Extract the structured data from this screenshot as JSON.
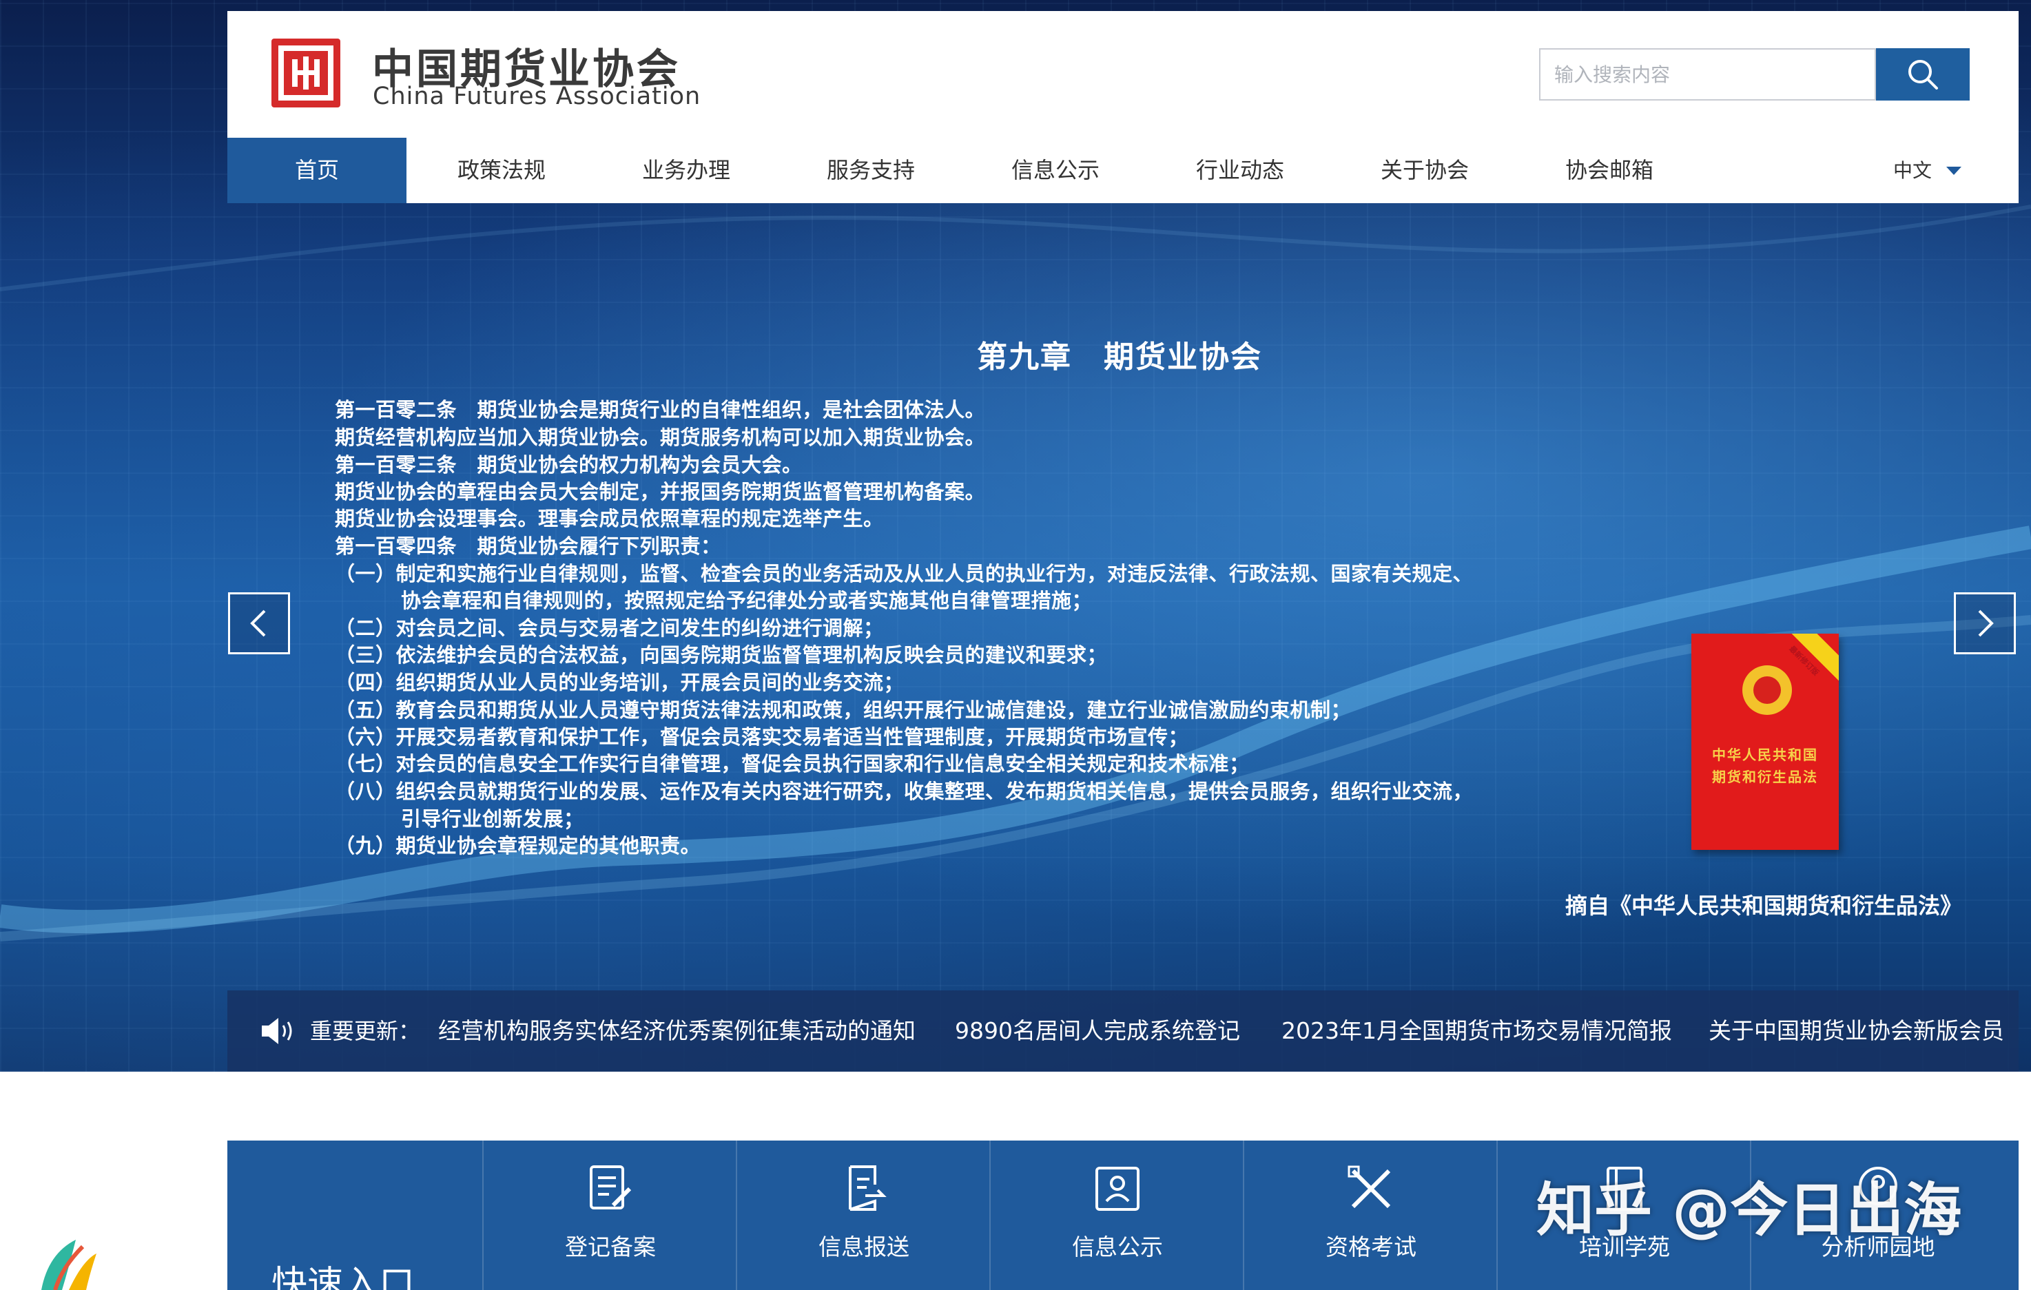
{
  "header": {
    "logo_cn": "中国期货业协会",
    "logo_en": "China Futures Association",
    "search_placeholder": "输入搜索内容"
  },
  "nav": {
    "items": [
      {
        "label": "首页",
        "active": true
      },
      {
        "label": "政策法规"
      },
      {
        "label": "业务办理"
      },
      {
        "label": "服务支持"
      },
      {
        "label": "信息公示"
      },
      {
        "label": "行业动态"
      },
      {
        "label": "关于协会"
      },
      {
        "label": "协会邮箱"
      }
    ],
    "language": "中文"
  },
  "banner": {
    "chapter_title": "第九章　期货业协会",
    "lines": [
      "第一百零二条　期货业协会是期货行业的自律性组织，是社会团体法人。",
      "期货经营机构应当加入期货业协会。期货服务机构可以加入期货业协会。",
      "第一百零三条　期货业协会的权力机构为会员大会。",
      "期货业协会的章程由会员大会制定，并报国务院期货监督管理机构备案。",
      "期货业协会设理事会。理事会成员依照章程的规定选举产生。",
      "第一百零四条　期货业协会履行下列职责：",
      "（一）制定和实施行业自律规则，监督、检查会员的业务活动及从业人员的执业行为，对违反法律、行政法规、国家有关规定、",
      "协会章程和自律规则的，按照规定给予纪律处分或者实施其他自律管理措施；",
      "（二）对会员之间、会员与交易者之间发生的纠纷进行调解；",
      "（三）依法维护会员的合法权益，向国务院期货监督管理机构反映会员的建议和要求；",
      "（四）组织期货从业人员的业务培训，开展会员间的业务交流；",
      "（五）教育会员和期货从业人员遵守期货法律法规和政策，组织开展行业诚信建设，建立行业诚信激励约束机制；",
      "（六）开展交易者教育和保护工作，督促会员落实交易者适当性管理制度，开展期货市场宣传；",
      "（七）对会员的信息安全工作实行自律管理，督促会员执行国家和行业信息安全相关规定和技术标准；",
      "（八）组织会员就期货行业的发展、运作及有关内容进行研究，收集整理、发布期货相关信息，提供会员服务，组织行业交流，",
      "引导行业创新发展；",
      "（九）期货业协会章程规定的其他职责。"
    ],
    "book_ribbon": "最新修订版",
    "book_title_1": "中华人民共和国",
    "book_title_2": "期货和衍生品法",
    "source": "摘自《中华人民共和国期货和衍生品法》"
  },
  "ticker": {
    "label": "重要更新：",
    "items": [
      "经营机构服务实体经济优秀案例征集活动的通知",
      "9890名居间人完成系统登记",
      "2023年1月全国期货市场交易情况简报",
      "关于中国期货业协会新版会员"
    ]
  },
  "quick": {
    "title": "快速入口",
    "items": [
      {
        "label": "登记备案",
        "icon": "edit-document-icon"
      },
      {
        "label": "信息报送",
        "icon": "document-send-icon"
      },
      {
        "label": "信息公示",
        "icon": "profile-card-icon"
      },
      {
        "label": "资格考试",
        "icon": "pencil-ruler-icon"
      },
      {
        "label": "培训学苑",
        "icon": "book-icon"
      },
      {
        "label": "分析师园地",
        "icon": "analyst-icon"
      }
    ]
  },
  "watermark": "知乎 @今日出海",
  "colors": {
    "nav_active": "#1f5a9c",
    "logo_red": "#d52b2b",
    "quick_bg": "#1f5a9c"
  }
}
